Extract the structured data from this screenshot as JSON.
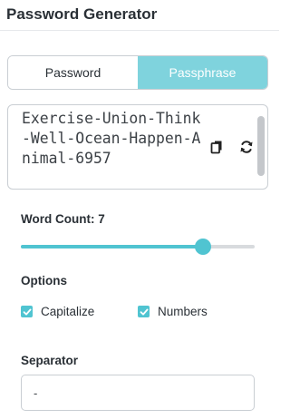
{
  "header": {
    "title": "Password Generator"
  },
  "mode_toggle": {
    "options": [
      {
        "label": "Password",
        "active": false
      },
      {
        "label": "Passphrase",
        "active": true
      }
    ]
  },
  "output": {
    "value": "Exercise-Union-Think-Well-Ocean-Happen-Animal-6957",
    "icons": {
      "copy": "copy-icon",
      "regenerate": "refresh-icon"
    }
  },
  "word_count": {
    "label": "Word Count: 7",
    "value": 7,
    "slider_fraction": 0.78
  },
  "options": {
    "label": "Options",
    "checkboxes": [
      {
        "label": "Capitalize",
        "checked": true
      },
      {
        "label": "Numbers",
        "checked": true
      }
    ]
  },
  "separator": {
    "label": "Separator",
    "value": "-"
  },
  "colors": {
    "accent": "#50c4d1",
    "accent_light": "#7fd3dd",
    "border": "#c9ced3",
    "text": "#2a3036"
  }
}
